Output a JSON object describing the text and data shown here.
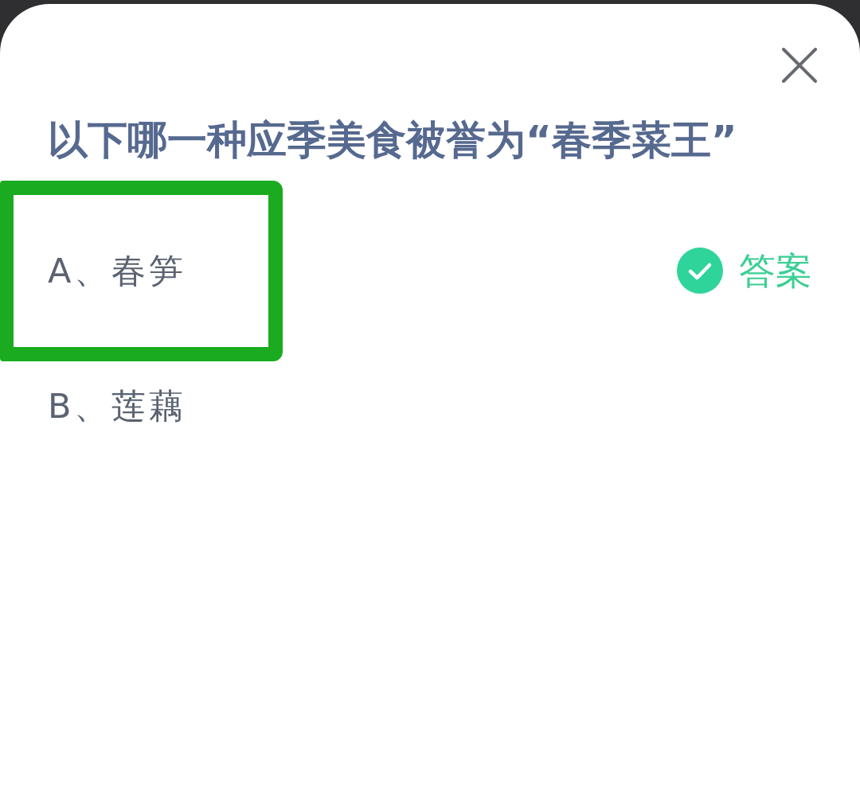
{
  "question": {
    "title": "以下哪一种应季美食被誉为“春季菜王”"
  },
  "options": [
    {
      "label": "A、春笋",
      "highlighted": true,
      "correct": true,
      "answer_label": "答案"
    },
    {
      "label": "B、莲藕",
      "highlighted": false,
      "correct": false
    }
  ]
}
